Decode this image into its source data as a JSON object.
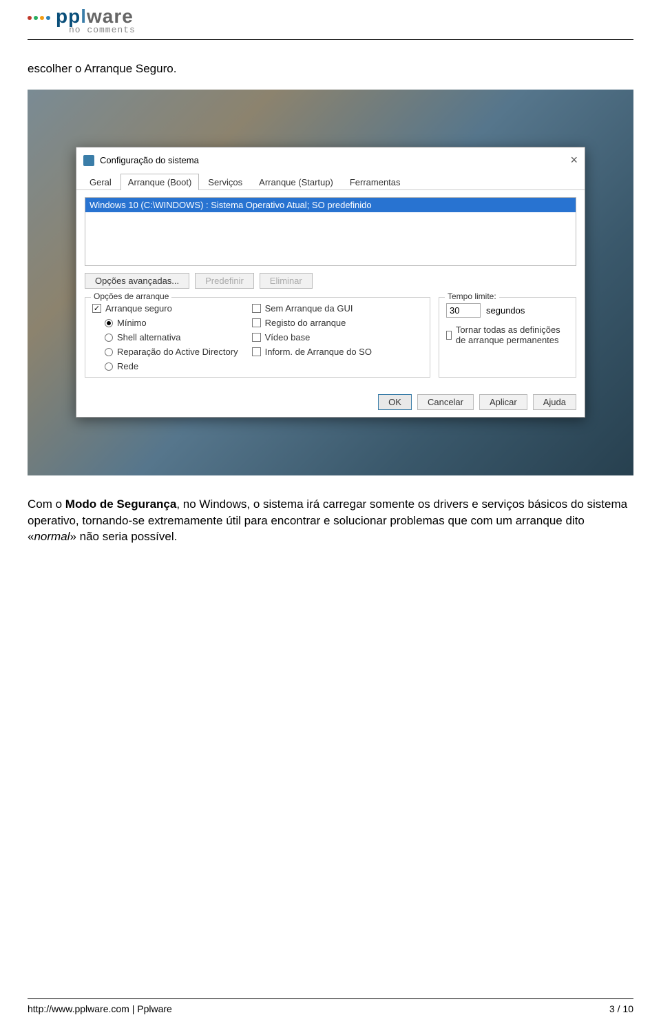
{
  "header": {
    "logo_prefix": "pp",
    "logo_mid": "l",
    "logo_suffix": "ware",
    "tagline": "no comments"
  },
  "article": {
    "para1": "escolher o Arranque Seguro.",
    "para2_pre": "Com o ",
    "para2_bold": "Modo de Segurança",
    "para2_post": ", no Windows, o sistema irá carregar somente os drivers e serviços básicos do sistema operativo, tornando-se extremamente útil para encontrar e solucionar problemas que com um arranque dito «",
    "para2_ital": "normal",
    "para2_end": "» não seria possível."
  },
  "dialog": {
    "title": "Configuração do sistema",
    "tabs": {
      "geral": "Geral",
      "arranque_boot": "Arranque (Boot)",
      "servicos": "Serviços",
      "arranque_startup": "Arranque (Startup)",
      "ferramentas": "Ferramentas"
    },
    "os_entry": "Windows 10 (C:\\WINDOWS) : Sistema Operativo Atual; SO predefinido",
    "btn_advanced": "Opções avançadas...",
    "btn_predef": "Predefinir",
    "btn_eliminar": "Eliminar",
    "grp_boot_label": "Opções de arranque",
    "opt_safe": "Arranque seguro",
    "opt_min": "Mínimo",
    "opt_shell": "Shell alternativa",
    "opt_ad": "Reparação do Active Directory",
    "opt_rede": "Rede",
    "opt_noGUI": "Sem Arranque da GUI",
    "opt_reg": "Registo do arranque",
    "opt_video": "Vídeo base",
    "opt_info": "Inform. de Arranque do SO",
    "grp_time_label": "Tempo limite:",
    "time_value": "30",
    "time_unit": "segundos",
    "opt_perm": "Tornar todas as definições de arranque permanentes",
    "btn_ok": "OK",
    "btn_cancel": "Cancelar",
    "btn_apply": "Aplicar",
    "btn_help": "Ajuda"
  },
  "footer": {
    "left": "http://www.pplware.com | Pplware",
    "right": "3 / 10"
  }
}
